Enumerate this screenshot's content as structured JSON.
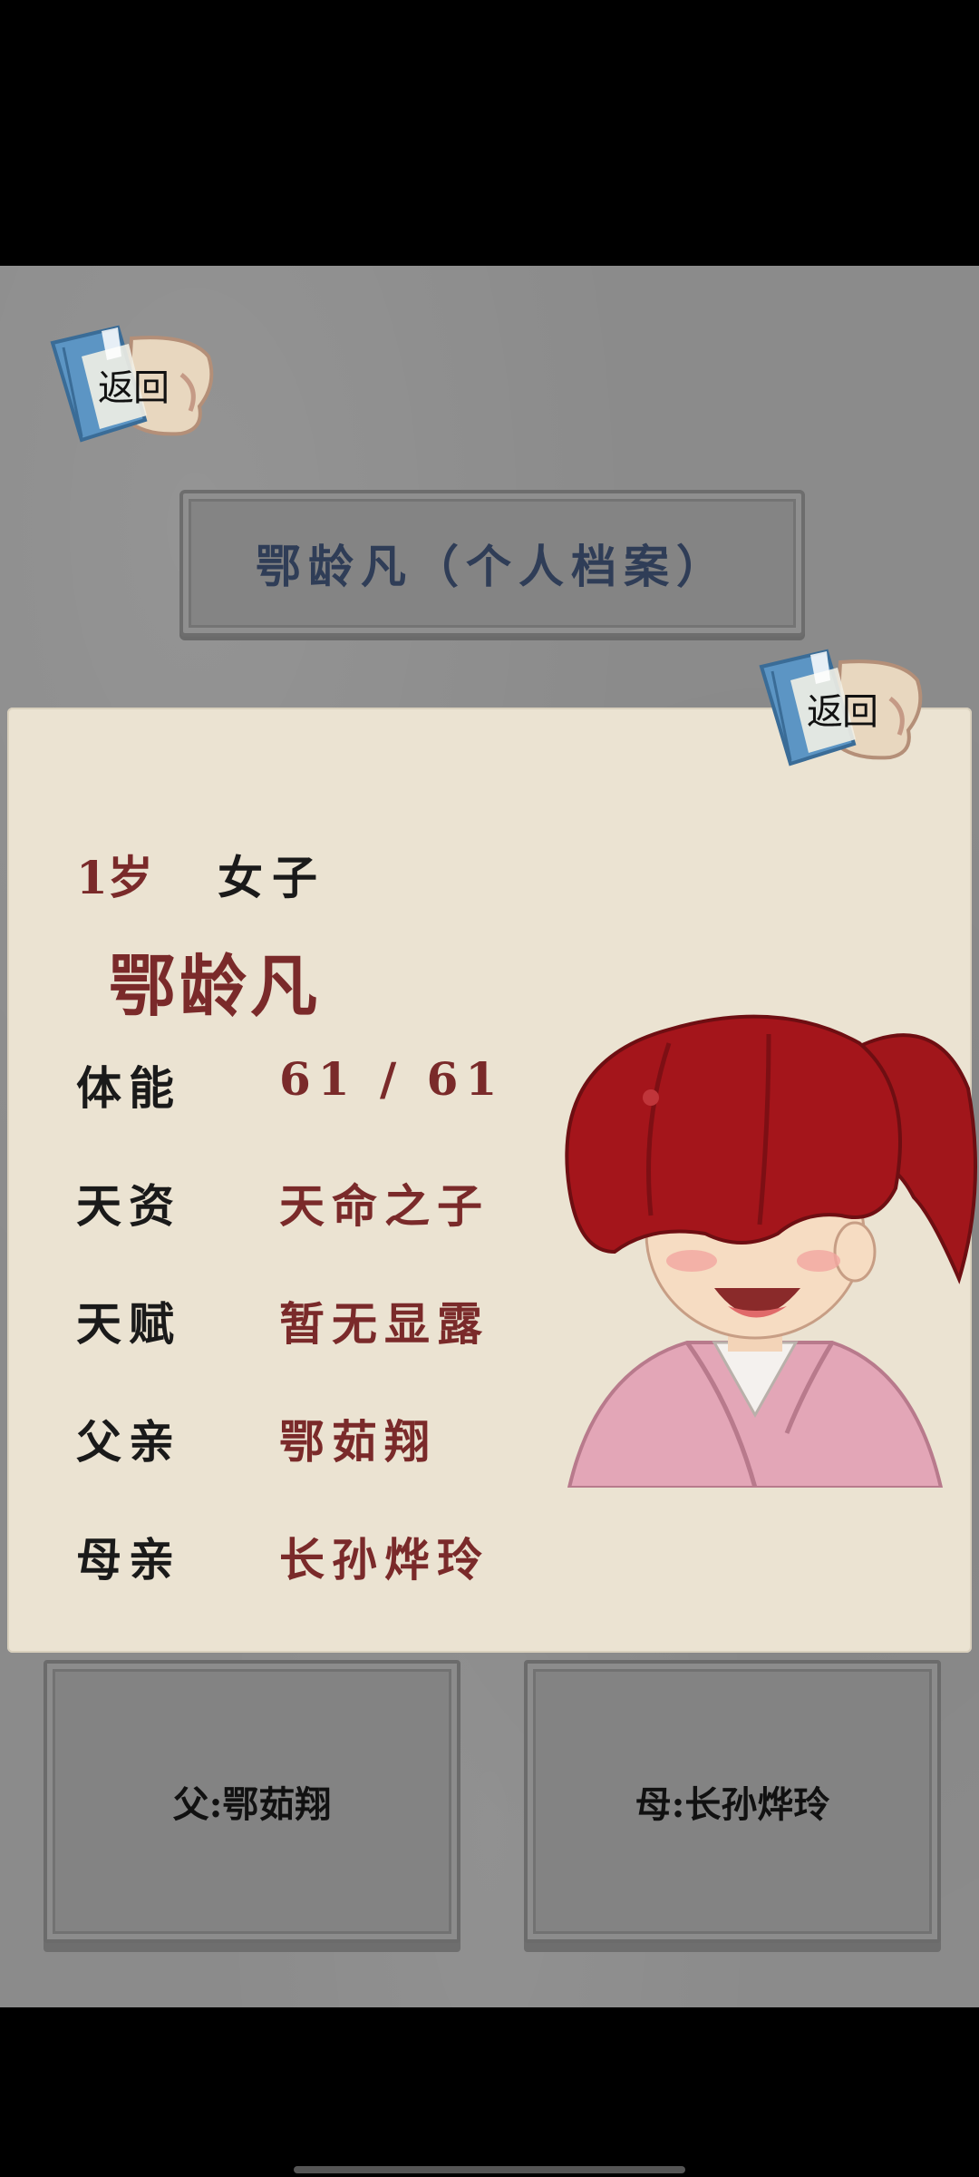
{
  "header": {
    "back_label": "返回",
    "title": "鄂龄凡（个人档案）"
  },
  "card": {
    "back_label": "返回",
    "age": "1岁",
    "gender": "女子",
    "name": "鄂龄凡",
    "stats": [
      {
        "label": "体能",
        "value": "61 / 61"
      },
      {
        "label": "天资",
        "value": "天命之子"
      },
      {
        "label": "天赋",
        "value": "暂无显露"
      },
      {
        "label": "父亲",
        "value": "鄂茹翔"
      },
      {
        "label": "母亲",
        "value": "长孙烨玲"
      }
    ],
    "portrait_icon": "red-ponytail-girl-portrait"
  },
  "buttons": {
    "father": "父:鄂茹翔",
    "mother": "母:长孙烨玲"
  },
  "colors": {
    "background": "#8b8b8b",
    "paper": "#ebe3d2",
    "accent_red": "#7a2a2a",
    "title_blue": "#2f3d57"
  }
}
